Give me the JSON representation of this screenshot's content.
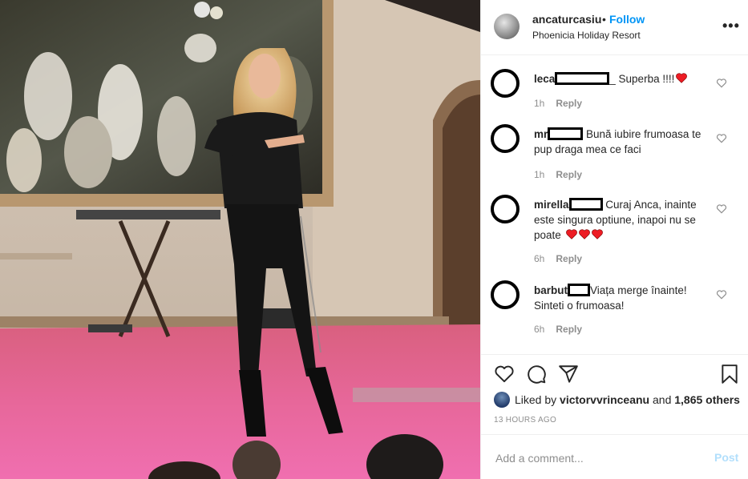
{
  "post": {
    "username": "ancaturcasiu",
    "separator": "•",
    "follow_label": "Follow",
    "location": "Phoenicia Holiday Resort",
    "more_icon": "more-options-icon"
  },
  "comments": [
    {
      "user": "leca",
      "text": "_ Superba !!!!",
      "emoji": "heart",
      "time": "1h",
      "reply": "Reply"
    },
    {
      "user": "mr",
      "text": "Bună iubire frumoasa te pup draga mea ce faci",
      "time": "1h",
      "reply": "Reply"
    },
    {
      "user": "mirella",
      "text": "Curaj Anca, inainte este singura optiune, inapoi nu se poate",
      "emoji": "heart",
      "time": "6h",
      "reply": "Reply"
    },
    {
      "user": "barbut",
      "text": "Viața merge înainte! Sinteti o frumoasa!",
      "time": "6h",
      "reply": "Reply"
    }
  ],
  "likes": {
    "prefix": "Liked by",
    "user": "victorvvrinceanu",
    "middle": "and",
    "count": "1,865 others"
  },
  "timestamp": "13 HOURS AGO",
  "add_comment": {
    "placeholder": "Add a comment...",
    "post_label": "Post"
  },
  "colors": {
    "accent": "#0095f6",
    "post_disabled": "#b2dffc",
    "heart": "#ed1c24"
  }
}
